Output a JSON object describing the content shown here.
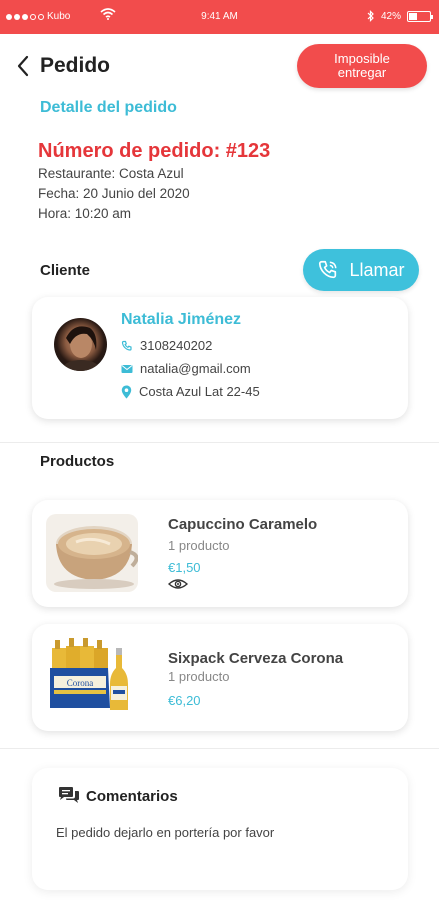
{
  "status_bar": {
    "carrier": "Kubo",
    "time": "9:41 AM",
    "battery": "42%",
    "battery_level": 0.42
  },
  "header": {
    "title": "Pedido",
    "impossible_button_label": "Imposible entregar"
  },
  "order": {
    "section_link": "Detalle del pedido",
    "number_label": "Número de pedido: #123",
    "restaurant": "Restaurante: Costa Azul",
    "date": "Fecha: 20 Junio del 2020",
    "time": "Hora: 10:20 am"
  },
  "client": {
    "heading": "Cliente",
    "call_button_label": "Llamar",
    "name": "Natalia Jiménez",
    "phone": "3108240202",
    "email": "natalia@gmail.com",
    "address": "Costa Azul Lat 22-45"
  },
  "products": {
    "heading": "Productos",
    "items": [
      {
        "name": "Capuccino Caramelo",
        "quantity": "1 producto",
        "price": "€1,50"
      },
      {
        "name": "Sixpack Cerveza Corona",
        "quantity": "1 producto",
        "price": "€6,20"
      }
    ]
  },
  "comments": {
    "title": "Comentarios",
    "text": "El pedido dejarlo en portería por favor"
  },
  "colors": {
    "accent_red": "#f24c4c",
    "accent_cyan": "#3dbcd6",
    "order_number_red": "#e5363a"
  },
  "icons": [
    "back-chevron-icon",
    "phone-icon",
    "mail-icon",
    "location-pin-icon",
    "eye-icon",
    "chat-icon",
    "wifi-icon",
    "bluetooth-icon",
    "battery-icon"
  ]
}
